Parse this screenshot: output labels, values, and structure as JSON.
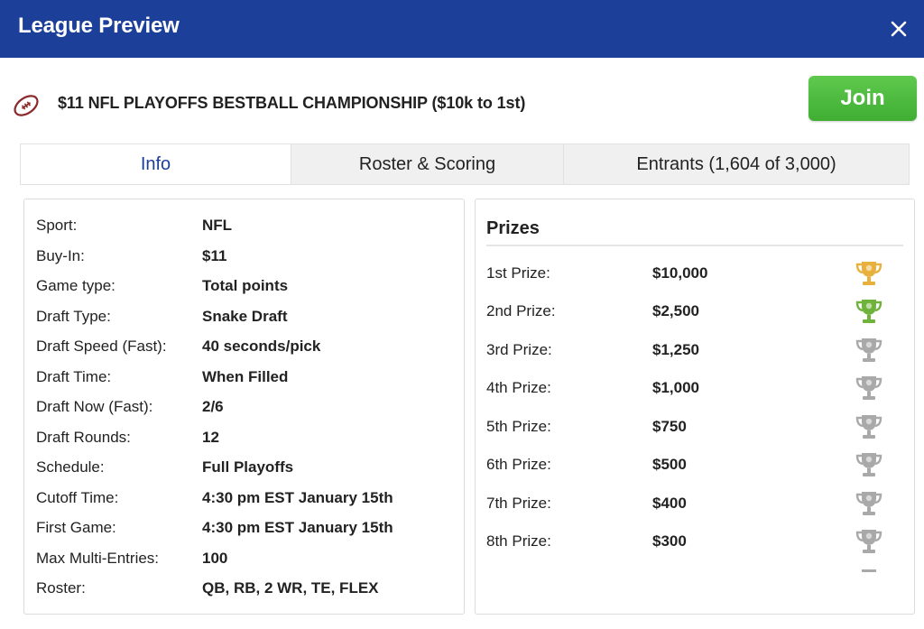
{
  "header": {
    "title": "League Preview",
    "close_icon": "close-icon"
  },
  "league": {
    "icon": "football-icon",
    "name": "$11 NFL PLAYOFFS BESTBALL CHAMPIONSHIP ($10k to 1st)",
    "join_label": "Join"
  },
  "tabs": [
    {
      "label": "Info",
      "active": true
    },
    {
      "label": "Roster & Scoring",
      "active": false
    },
    {
      "label": "Entrants (1,604 of 3,000)",
      "active": false
    }
  ],
  "info": [
    {
      "label": "Sport:",
      "value": "NFL"
    },
    {
      "label": "Buy-In:",
      "value": "$11"
    },
    {
      "label": "Game type:",
      "value": "Total points"
    },
    {
      "label": "Draft Type:",
      "value": "Snake Draft"
    },
    {
      "label": "Draft Speed (Fast):",
      "value": "40 seconds/pick"
    },
    {
      "label": "Draft Time:",
      "value": "When Filled"
    },
    {
      "label": "Draft Now (Fast):",
      "value": "2/6"
    },
    {
      "label": "Draft Rounds:",
      "value": "12"
    },
    {
      "label": "Schedule:",
      "value": "Full Playoffs"
    },
    {
      "label": "Cutoff Time:",
      "value": "4:30 pm EST January 15th"
    },
    {
      "label": "First Game:",
      "value": "4:30 pm EST January 15th"
    },
    {
      "label": "Max Multi-Entries:",
      "value": "100"
    },
    {
      "label": "Roster:",
      "value": "QB, RB, 2 WR, TE, FLEX"
    }
  ],
  "prizes": {
    "title": "Prizes",
    "items": [
      {
        "label": "1st Prize:",
        "amount": "$10,000",
        "trophy": "gold",
        "icon": "trophy-icon"
      },
      {
        "label": "2nd Prize:",
        "amount": "$2,500",
        "trophy": "green",
        "icon": "trophy-icon"
      },
      {
        "label": "3rd Prize:",
        "amount": "$1,250",
        "trophy": "silver",
        "icon": "trophy-icon"
      },
      {
        "label": "4th Prize:",
        "amount": "$1,000",
        "trophy": "silver",
        "icon": "trophy-icon"
      },
      {
        "label": "5th Prize:",
        "amount": "$750",
        "trophy": "silver",
        "icon": "trophy-icon"
      },
      {
        "label": "6th Prize:",
        "amount": "$500",
        "trophy": "silver",
        "icon": "trophy-icon"
      },
      {
        "label": "7th Prize:",
        "amount": "$400",
        "trophy": "silver",
        "icon": "trophy-icon"
      },
      {
        "label": "8th Prize:",
        "amount": "$300",
        "trophy": "silver",
        "icon": "trophy-icon"
      }
    ]
  },
  "colors": {
    "header_bg": "#1c3f99",
    "active_tab_text": "#1c3f99",
    "join_button": "#46b43a",
    "football": "#8a2a2a",
    "trophy_gold": "#e8b13d",
    "trophy_green": "#6fb33c",
    "trophy_silver": "#a9a9a9"
  }
}
